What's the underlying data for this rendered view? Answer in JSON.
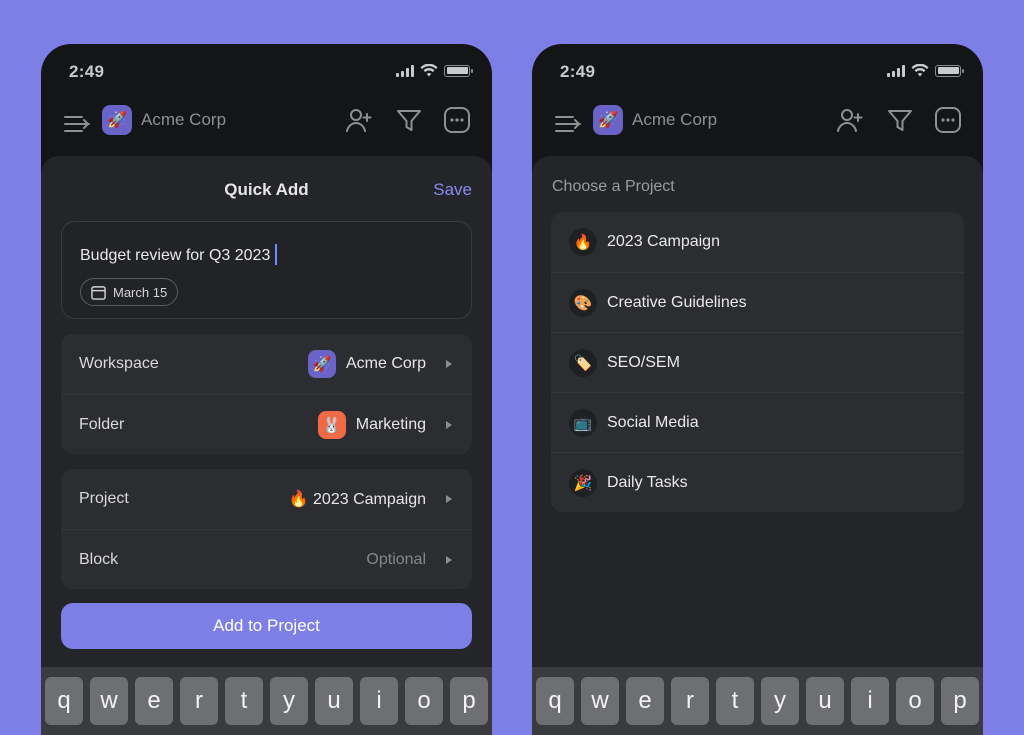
{
  "status": {
    "time": "2:49"
  },
  "header": {
    "workspace_name": "Acme Corp",
    "workspace_emoji": "🚀"
  },
  "quick_add": {
    "title": "Quick Add",
    "save_label": "Save",
    "task_text": "Budget review for Q3 2023",
    "due_date": "March 15",
    "workspace": {
      "label": "Workspace",
      "value": "Acme Corp",
      "emoji": "🚀"
    },
    "folder": {
      "label": "Folder",
      "value": "Marketing",
      "emoji": "🐰"
    },
    "project": {
      "label": "Project",
      "value": "🔥 2023 Campaign"
    },
    "block": {
      "label": "Block",
      "value": "Optional"
    },
    "primary_button": "Add to Project"
  },
  "project_picker": {
    "title": "Choose a Project",
    "projects": [
      {
        "emoji": "🔥",
        "name": "2023 Campaign"
      },
      {
        "emoji": "🎨",
        "name": "Creative Guidelines"
      },
      {
        "emoji": "🏷️",
        "name": "SEO/SEM"
      },
      {
        "emoji": "📺",
        "name": "Social Media"
      },
      {
        "emoji": "🎉",
        "name": "Daily Tasks"
      }
    ]
  },
  "keyboard": {
    "keys": [
      "q",
      "w",
      "e",
      "r",
      "t",
      "y",
      "u",
      "i",
      "o",
      "p"
    ]
  },
  "colors": {
    "background": "#7d7fe6",
    "accent": "#8b88f0",
    "sheet": "#242528"
  }
}
